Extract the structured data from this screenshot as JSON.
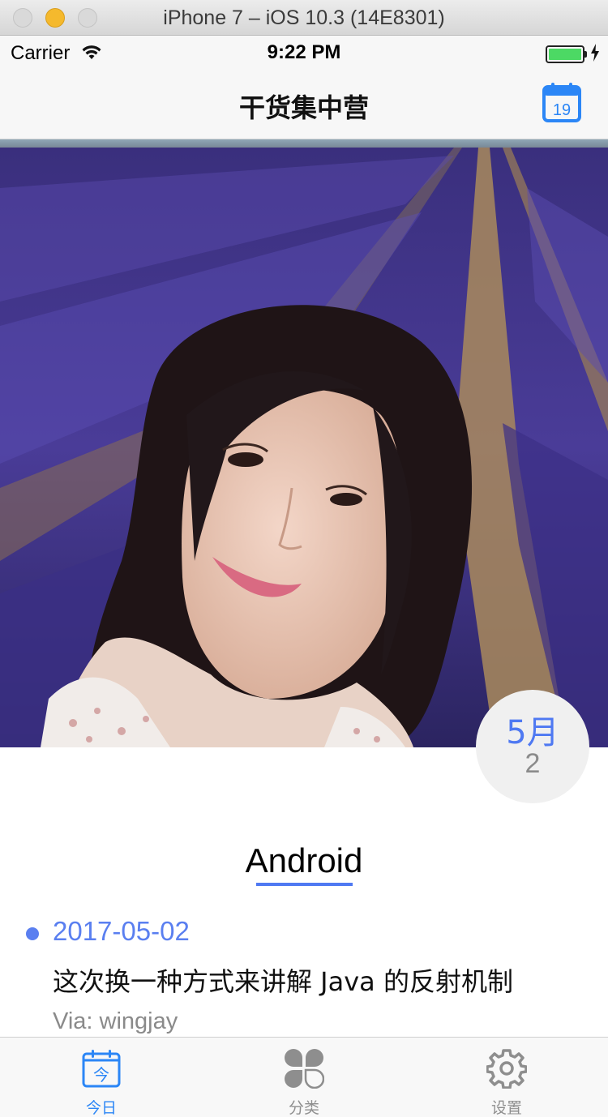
{
  "window": {
    "title": "iPhone 7 – iOS 10.3 (14E8301)"
  },
  "status_bar": {
    "carrier": "Carrier",
    "time": "9:22 PM",
    "battery_level": 1.0
  },
  "nav": {
    "title": "干货集中营",
    "calendar_icon_day": "19"
  },
  "hero": {
    "description_icon": "photo"
  },
  "date_badge": {
    "month": "5月",
    "day": "2"
  },
  "section": {
    "title": "Android"
  },
  "article": {
    "date": "2017-05-02",
    "title": "这次换一种方式来讲解 Java 的反射机制",
    "via": "Via: wingjay"
  },
  "tabs": [
    {
      "label": "今日",
      "icon": "today-calendar-icon",
      "active": true
    },
    {
      "label": "分类",
      "icon": "category-icon",
      "active": false
    },
    {
      "label": "设置",
      "icon": "gear-icon",
      "active": false
    }
  ],
  "colors": {
    "accent": "#4f79f2",
    "tab_active": "#2b86f6",
    "tab_inactive": "#8e8e8e",
    "battery": "#4cd964"
  }
}
